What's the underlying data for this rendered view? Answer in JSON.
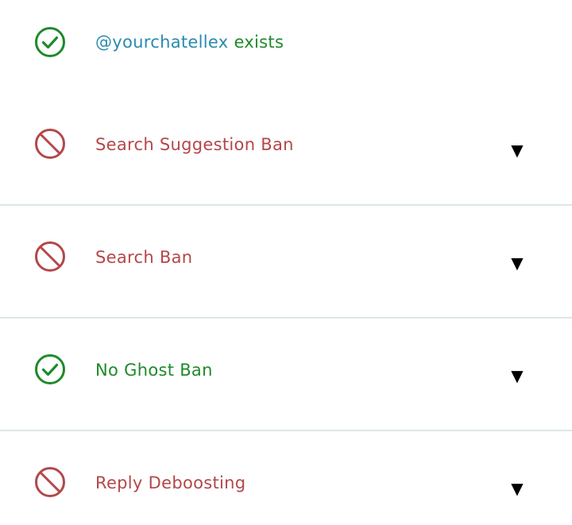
{
  "colors": {
    "ok": "#1e8a2a",
    "ban": "#b4474a",
    "handle": "#2a8ab0",
    "divider": "#dde6e8"
  },
  "header": {
    "status_icon": "check-circle-icon",
    "handle": "@yourchatellex",
    "suffix": " exists"
  },
  "checks": [
    {
      "status": "ban",
      "icon": "no-entry-icon",
      "label": "Search Suggestion Ban",
      "chevron": "▼"
    },
    {
      "status": "ban",
      "icon": "no-entry-icon",
      "label": "Search Ban",
      "chevron": "▼"
    },
    {
      "status": "ok",
      "icon": "check-circle-icon",
      "label": "No Ghost Ban",
      "chevron": "▼"
    },
    {
      "status": "ban",
      "icon": "no-entry-icon",
      "label": "Reply Deboosting",
      "chevron": "▼"
    }
  ]
}
